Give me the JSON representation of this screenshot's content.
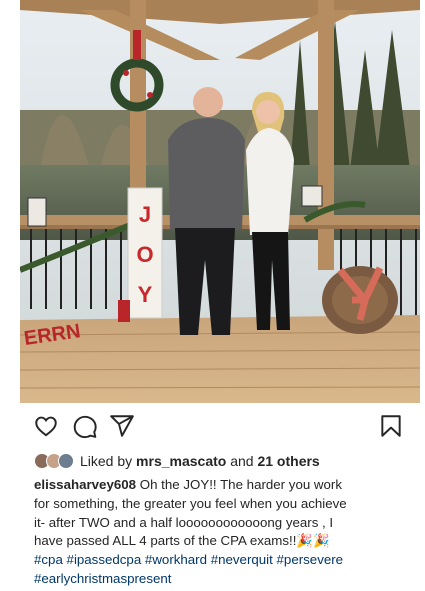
{
  "post": {
    "image_alt": "Couple in front of a decorated gazebo with JOY sign",
    "joy_letters": [
      "J",
      "O",
      "Y"
    ],
    "merry_sign": "ERRN"
  },
  "actions": {
    "icons": [
      "heart-icon",
      "comment-icon",
      "share-icon",
      "bookmark-icon"
    ]
  },
  "likes": {
    "prefix": "Liked by",
    "user": "mrs_mascato",
    "middle": "and",
    "count_text": "21 others"
  },
  "caption": {
    "username": "elissaharvey608",
    "line1": "Oh the JOY!! The harder you work",
    "line2": "for something, the greater you feel when you achieve",
    "line3": "it- after TWO and a half loooooooooooong years , I",
    "line4": "have passed ALL 4 parts of the CPA exams!!",
    "party_emoji": "🎉🎉",
    "hashtags": [
      "#cpa",
      "#ipassedcpa",
      "#workhard",
      "#neverquit",
      "#persevere",
      "#earlychristmaspresent"
    ]
  },
  "colors": {
    "text": "#262626",
    "hashtag": "#00376b",
    "background": "#ffffff"
  }
}
